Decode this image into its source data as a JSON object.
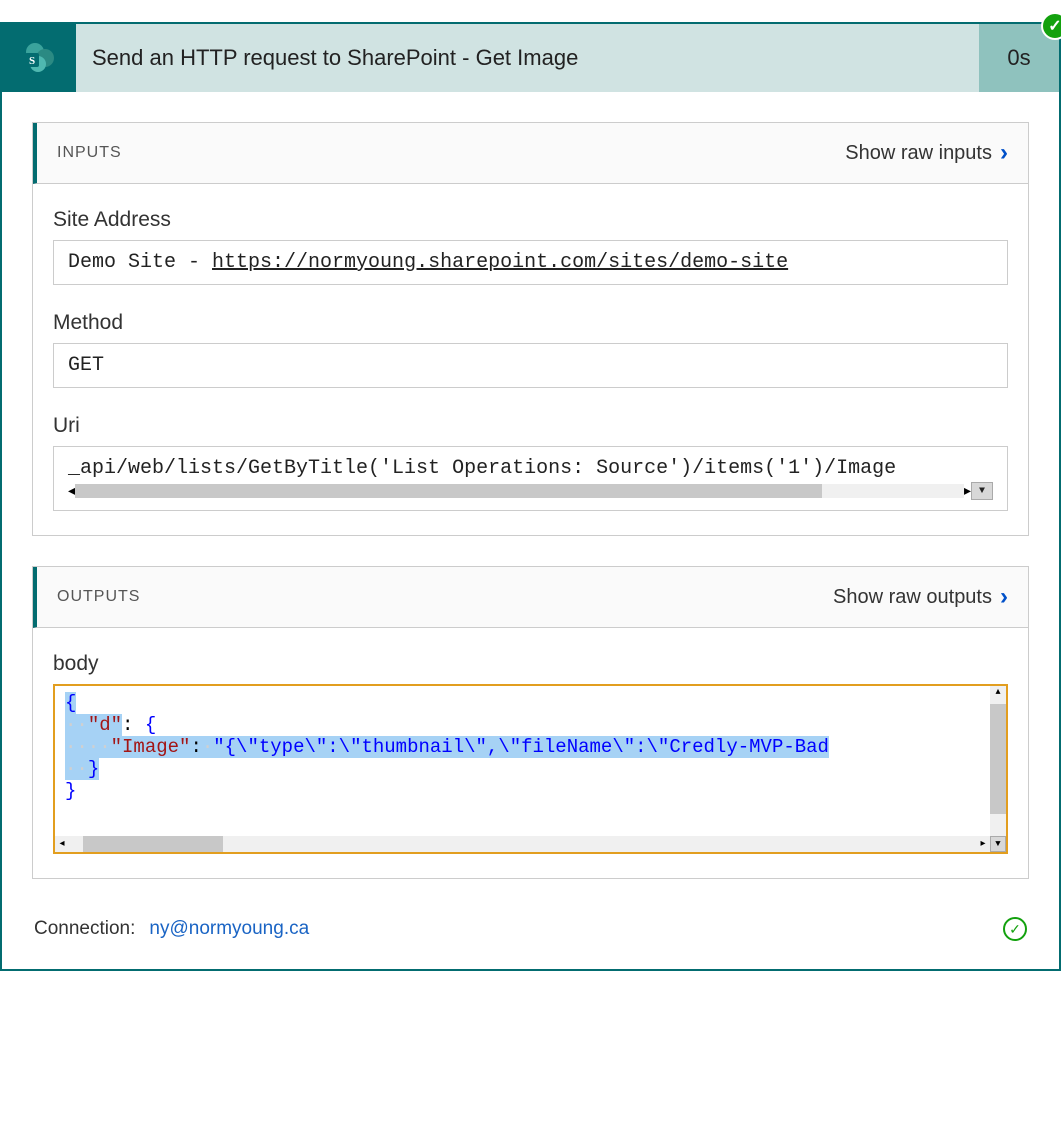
{
  "header": {
    "title": "Send an HTTP request to SharePoint - Get Image",
    "duration": "0s",
    "icon": "sharepoint-icon"
  },
  "status": "success",
  "inputs": {
    "section_title": "INPUTS",
    "show_raw_label": "Show raw inputs",
    "site_address": {
      "label": "Site Address",
      "prefix": "Demo Site - ",
      "url": "https://normyoung.sharepoint.com/sites/demo-site"
    },
    "method": {
      "label": "Method",
      "value": "GET"
    },
    "uri": {
      "label": "Uri",
      "value": "_api/web/lists/GetByTitle('List Operations: Source')/items('1')/Image"
    }
  },
  "outputs": {
    "section_title": "OUTPUTS",
    "show_raw_label": "Show raw outputs",
    "body": {
      "label": "body",
      "json_lines": {
        "l1": "{",
        "l2_dots": "··",
        "l2_key": "\"d\"",
        "l2_colon": ": ",
        "l2_brace": "{",
        "l3_dots": "····",
        "l3_key": "\"Image\"",
        "l3_colon": ":",
        "l3_dots2": "·",
        "l3_val": "\"{\\\"type\\\":\\\"thumbnail\\\",\\\"fileName\\\":\\\"Credly-MVP-Bad",
        "l4_dots": "··",
        "l4_brace": "}",
        "l5": "}"
      }
    }
  },
  "connection": {
    "label": "Connection:",
    "value": "ny@normyoung.ca"
  }
}
